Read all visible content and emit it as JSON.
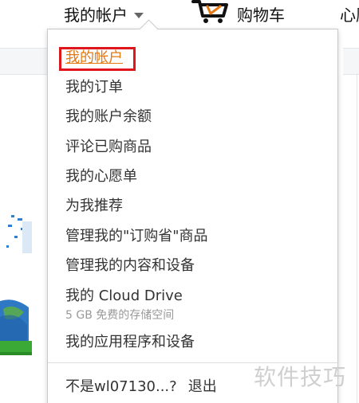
{
  "nav": {
    "account_label": "我的帐户",
    "cart_label": "购物车",
    "wishlist_label": "心愿单"
  },
  "dropdown": {
    "items": [
      {
        "label": "我的帐户",
        "active": true
      },
      {
        "label": "我的订单"
      },
      {
        "label": "我的账户余额"
      },
      {
        "label": "评论已购商品"
      },
      {
        "label": "我的心愿单"
      },
      {
        "label": "为我推荐"
      },
      {
        "label": "管理我的\"订购省\"商品"
      },
      {
        "label": "管理我的内容和设备"
      },
      {
        "label": "我的 Cloud Drive",
        "sub": "5 GB 免费的存储空间"
      },
      {
        "label": "我的应用程序和设备"
      }
    ],
    "signout": {
      "prompt": "不是wl07130...?",
      "logout_label": "退出"
    }
  },
  "watermark": "软件技巧",
  "colors": {
    "active_link": "#e47911",
    "highlight_border": "#e0161d",
    "sub_text": "#999999",
    "menu_text": "#333333"
  }
}
